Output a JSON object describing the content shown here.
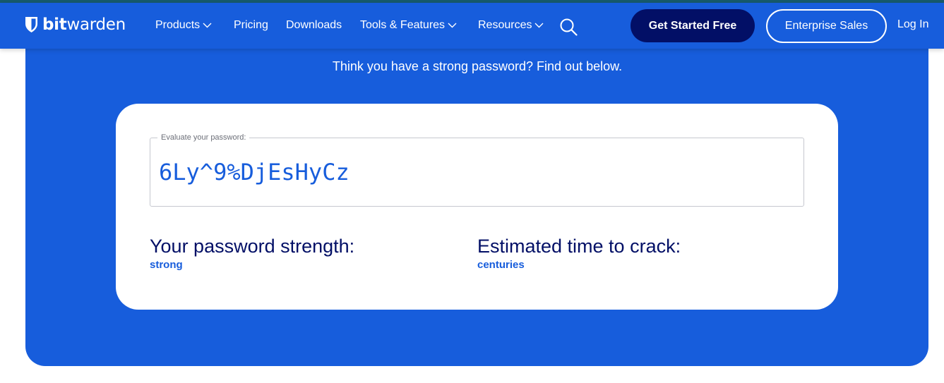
{
  "brand": {
    "name_bold": "bit",
    "name_regular": "warden",
    "icon": "shield-icon"
  },
  "nav": {
    "products": "Products",
    "pricing": "Pricing",
    "downloads": "Downloads",
    "tools": "Tools & Features",
    "resources": "Resources",
    "search_icon": "search-icon",
    "get_started": "Get Started Free",
    "enterprise": "Enterprise Sales",
    "login": "Log In"
  },
  "hero": {
    "tagline": "Think you have a strong password? Find out below."
  },
  "checker": {
    "field_label": "Evaluate your password:",
    "password_value": "6Ly^9%DjEsHyCz",
    "strength_heading": "Your password strength:",
    "strength_value": "strong",
    "crack_heading": "Estimated time to crack:",
    "crack_value": "centuries"
  },
  "colors": {
    "brand_blue": "#175ddc",
    "navy": "#020f66",
    "top_strip": "#175a6c"
  }
}
